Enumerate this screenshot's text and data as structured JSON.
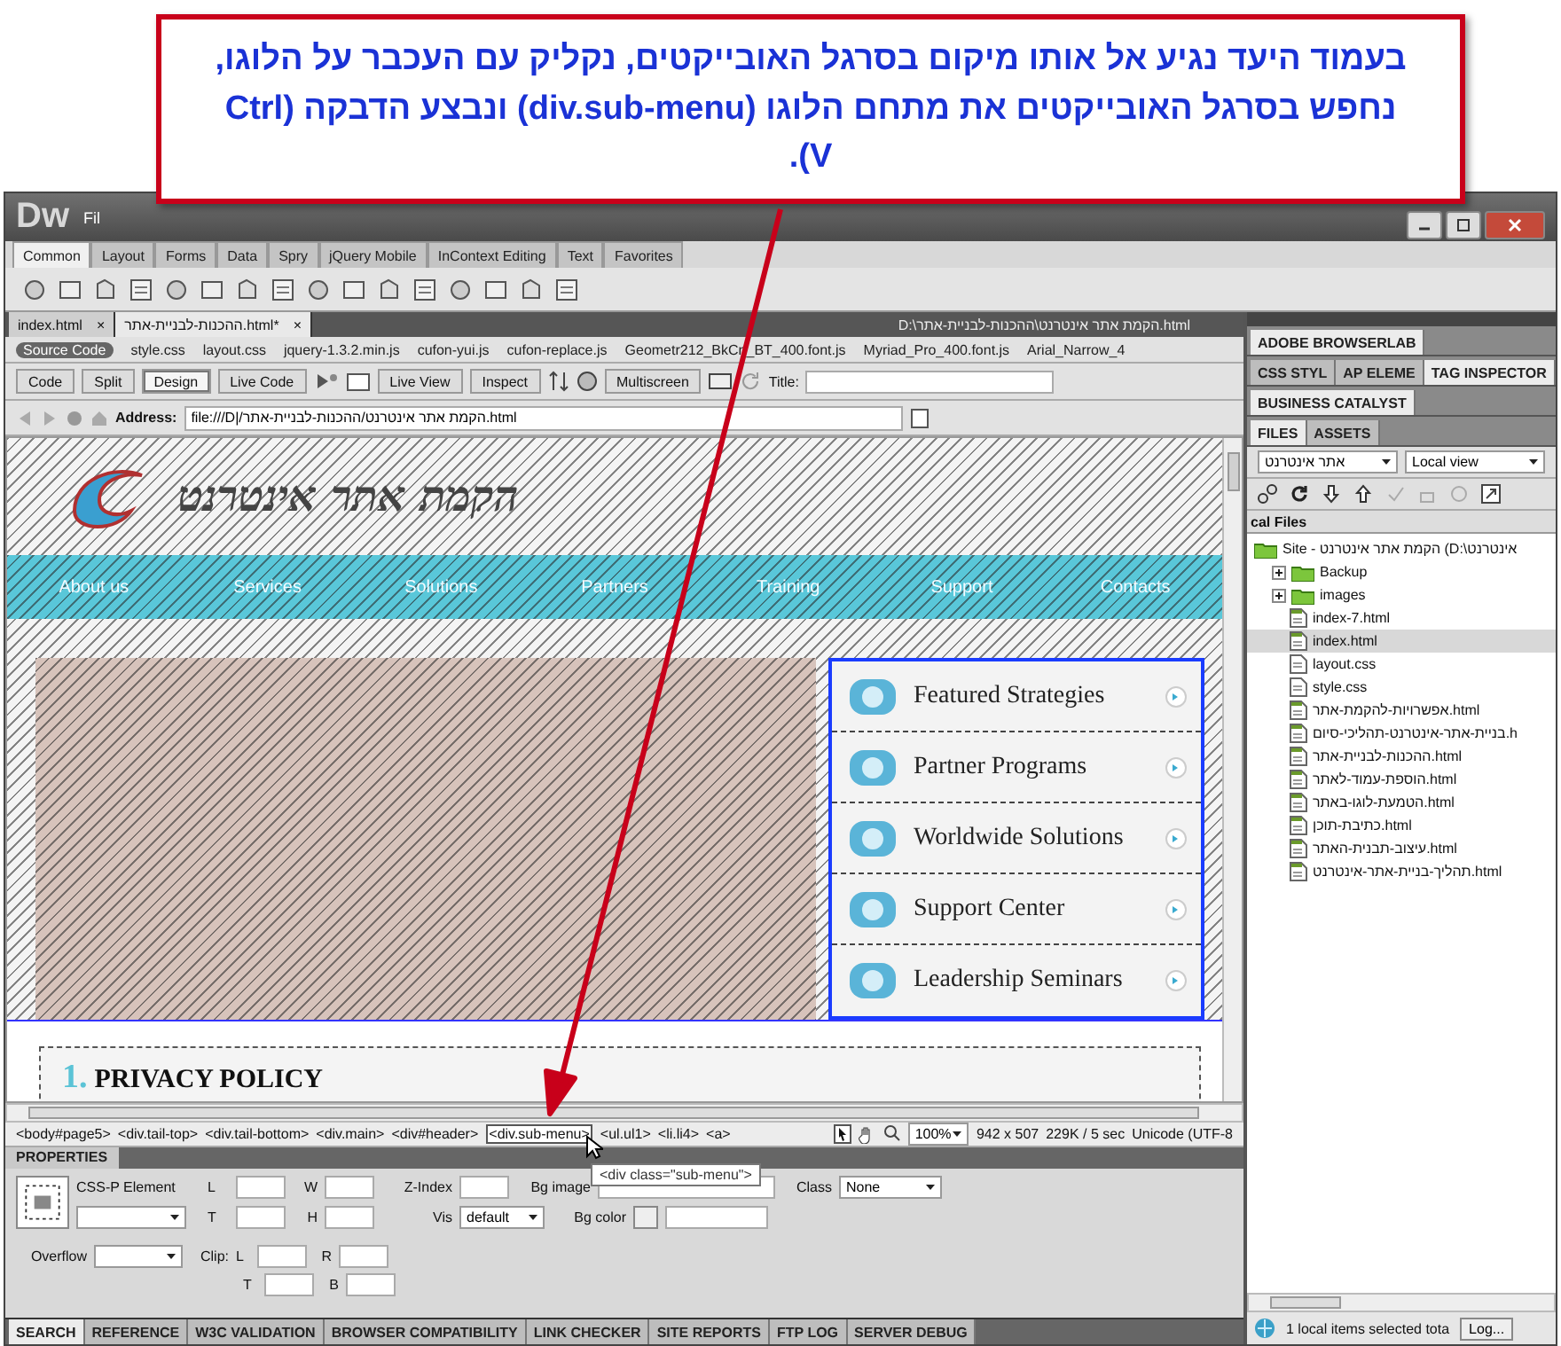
{
  "callout": {
    "text": "בעמוד היעד נגיע אל אותו מיקום בסרגל האובייקטים, נקליק עם העכבר על הלוגו, נחפש בסרגל האובייקטים את מתחם הלוגו (div.sub-menu) ונבצע הדבקה (Ctrl V)."
  },
  "window": {
    "logo": "Dw",
    "menu": [
      "Fil"
    ]
  },
  "insert_bar": {
    "tabs": [
      {
        "label": "Common",
        "selected": true
      },
      {
        "label": "Layout",
        "selected": false
      },
      {
        "label": "Forms",
        "selected": false
      },
      {
        "label": "Data",
        "selected": false
      },
      {
        "label": "Spry",
        "selected": false
      },
      {
        "label": "jQuery Mobile",
        "selected": false
      },
      {
        "label": "InContext Editing",
        "selected": false
      },
      {
        "label": "Text",
        "selected": false
      },
      {
        "label": "Favorites",
        "selected": false
      }
    ]
  },
  "documents": {
    "tabs": [
      {
        "label": "index.html",
        "selected": false,
        "close": "×"
      },
      {
        "label": "ההכנות-לבניית-אתר.html*",
        "selected": true,
        "close": "×"
      }
    ],
    "path": "D:\\הקמת אתר אינטרנט\\ההכנות-לבניית-אתר.html"
  },
  "related_files": [
    {
      "label": "Source Code",
      "selected": true
    },
    {
      "label": "style.css",
      "selected": false
    },
    {
      "label": "layout.css",
      "selected": false
    },
    {
      "label": "jquery-1.3.2.min.js",
      "selected": false
    },
    {
      "label": "cufon-yui.js",
      "selected": false
    },
    {
      "label": "cufon-replace.js",
      "selected": false
    },
    {
      "label": "Geometr212_BkCn_BT_400.font.js",
      "selected": false
    },
    {
      "label": "Myriad_Pro_400.font.js",
      "selected": false
    },
    {
      "label": "Arial_Narrow_4",
      "selected": false
    }
  ],
  "doc_toolbar": {
    "views": [
      {
        "label": "Code",
        "selected": false
      },
      {
        "label": "Split",
        "selected": false
      },
      {
        "label": "Design",
        "selected": true
      }
    ],
    "live_code": "Live Code",
    "live_view": "Live View",
    "inspect": "Inspect",
    "multiscreen": "Multiscreen",
    "title_label": "Title:"
  },
  "address": {
    "label": "Address:",
    "value": "file:///D|/הקמת אתר אינטרנט/ההכנות-לבניית-אתר.html"
  },
  "design": {
    "logo_text": "הקמת אתר אינטרנט",
    "nav": [
      "About us",
      "Services",
      "Solutions",
      "Partners",
      "Training",
      "Support",
      "Contacts"
    ],
    "sub_menu": [
      "Featured Strategies",
      "Partner Programs",
      "Worldwide Solutions",
      "Support Center",
      "Leadership Seminars"
    ],
    "section_number": "1.",
    "section_title": "PRIVACY POLICY"
  },
  "tag_selector": {
    "tags": [
      {
        "label": "<body#page5>",
        "selected": false
      },
      {
        "label": "<div.tail-top>",
        "selected": false
      },
      {
        "label": "<div.tail-bottom>",
        "selected": false
      },
      {
        "label": "<div.main>",
        "selected": false
      },
      {
        "label": "<div#header>",
        "selected": false
      },
      {
        "label": "<div.sub-menu>",
        "selected": true
      },
      {
        "label": "<ul.ul1>",
        "selected": false
      },
      {
        "label": "<li.li4>",
        "selected": false
      },
      {
        "label": "<a>",
        "selected": false
      }
    ],
    "tooltip": "<div class=\"sub-menu\">",
    "zoom": "100%",
    "size": "942 x 507",
    "download": "229K / 5 sec",
    "encoding": "Unicode (UTF-8"
  },
  "properties": {
    "title": "PROPERTIES",
    "element": "CSS-P Element",
    "l": "L",
    "w": "W",
    "z_index": "Z-Index",
    "bg_image": "Bg image",
    "class": "Class",
    "class_value": "None",
    "t": "T",
    "h": "H",
    "vis": "Vis",
    "vis_value": "default",
    "bg_color": "Bg color",
    "overflow": "Overflow",
    "clip": "Clip:",
    "clip_l": "L",
    "clip_r": "R",
    "clip_t": "T",
    "clip_b": "B"
  },
  "bottom_tabs": [
    {
      "label": "SEARCH",
      "selected": true
    },
    {
      "label": "REFERENCE",
      "selected": false
    },
    {
      "label": "W3C VALIDATION",
      "selected": false
    },
    {
      "label": "BROWSER COMPATIBILITY",
      "selected": false
    },
    {
      "label": "LINK CHECKER",
      "selected": false
    },
    {
      "label": "SITE REPORTS",
      "selected": false
    },
    {
      "label": "FTP LOG",
      "selected": false
    },
    {
      "label": "SERVER DEBUG",
      "selected": false
    }
  ],
  "panel_groups": [
    {
      "tabs": [
        {
          "label": "ADOBE BROWSERLAB",
          "selected": true
        }
      ]
    },
    {
      "tabs": [
        {
          "label": "CSS STYL",
          "selected": false
        },
        {
          "label": "AP ELEME",
          "selected": false
        },
        {
          "label": "TAG INSPECTOR",
          "selected": true
        }
      ]
    },
    {
      "tabs": [
        {
          "label": "BUSINESS CATALYST",
          "selected": true
        }
      ]
    },
    {
      "tabs": [
        {
          "label": "FILES",
          "selected": true
        },
        {
          "label": "ASSETS",
          "selected": false
        }
      ]
    }
  ],
  "files": {
    "site": "אתר אינטרנט",
    "view": "Local view",
    "header": "cal Files",
    "tree": [
      {
        "label": "Site - הקמת אתר אינטרנט (D:\\אינטרנט",
        "kind": "folder",
        "selected": false,
        "children": [
          {
            "label": "Backup",
            "kind": "folder",
            "expanded": false,
            "selected": false
          },
          {
            "label": "images",
            "kind": "folder",
            "expanded": false,
            "selected": false
          },
          {
            "label": "index-7.html",
            "kind": "html",
            "selected": false
          },
          {
            "label": "index.html",
            "kind": "html",
            "selected": true
          },
          {
            "label": "layout.css",
            "kind": "css",
            "selected": false
          },
          {
            "label": "style.css",
            "kind": "css",
            "selected": false
          },
          {
            "label": "אפשרויות-להקמת-אתר.html",
            "kind": "html",
            "selected": false
          },
          {
            "label": "בניית-אתר-אינטרנט-תהליכי-סיום.h",
            "kind": "html",
            "selected": false
          },
          {
            "label": "ההכנות-לבניית-אתר.html",
            "kind": "html",
            "selected": false
          },
          {
            "label": "הוספת-עמוד-לאתר.html",
            "kind": "html",
            "selected": false
          },
          {
            "label": "הטמעת-לוגו-באתר.html",
            "kind": "html",
            "selected": false
          },
          {
            "label": "כתיבת-תוכן.html",
            "kind": "html",
            "selected": false
          },
          {
            "label": "עיצוב-תבנית-האתר.html",
            "kind": "html",
            "selected": false
          },
          {
            "label": "תהליך-בניית-אתר-אינטרנט.html",
            "kind": "html",
            "selected": false
          }
        ]
      }
    ],
    "status": "1 local items selected tota",
    "log_button": "Log..."
  }
}
